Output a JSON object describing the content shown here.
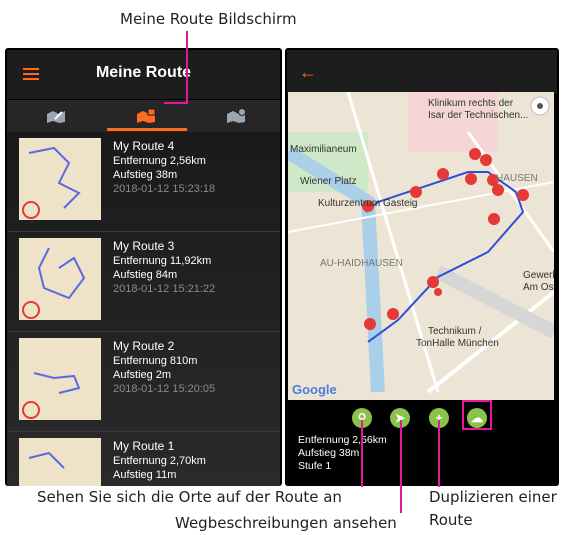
{
  "annotations": {
    "top_label": "Meine Route Bildschirm",
    "places_label": "Sehen Sie sich die Orte auf der Route an",
    "directions_label": "Wegbeschreibungen ansehen",
    "duplicate_label_1": "Duplizieren einer",
    "duplicate_label_2": "Route"
  },
  "left_screen": {
    "title": "Meine Route",
    "active_tab_index": 1,
    "routes": [
      {
        "name": "My Route 4",
        "distance": "Entfernung  2,56km",
        "ascent": "Aufstieg  38m",
        "date": "2018-01-12 15:23:18"
      },
      {
        "name": "My Route 3",
        "distance": "Entfernung  11,92km",
        "ascent": "Aufstieg  84m",
        "date": "2018-01-12 15:21:22"
      },
      {
        "name": "My Route 2",
        "distance": "Entfernung  810m",
        "ascent": "Aufstieg  2m",
        "date": "2018-01-12 15:20:05"
      },
      {
        "name": "My Route 1",
        "distance": "Entfernung  2,70km",
        "ascent": "Aufstieg  11m",
        "date": ""
      }
    ]
  },
  "right_screen": {
    "back_icon": "arrow-left-icon",
    "map_labels": {
      "klinikum": "Klinikum rechts der",
      "klinikum2": "Isar der Technischen...",
      "maximilianeum": "Maximilianeum",
      "wiener_platz": "Wiener Platz",
      "kulturzentrum": "Kulturzentrum Gasteig",
      "haidhausen": "AU-HAIDHAUSEN",
      "haidhausen_ne": "HAUSEN",
      "gewerbe": "Gewerb",
      "ost": "Am Ost",
      "technikum": "Technikum /",
      "tonhalle": "TonHalle München",
      "google": "Google"
    },
    "details": {
      "distance": "Entfernung  2,56km",
      "ascent": "Aufstieg  38m",
      "level": "Stufe  1"
    },
    "actions": [
      "location-pin-icon",
      "navigation-arrow-icon",
      "add-icon",
      "cloud-upload-icon"
    ]
  },
  "colors": {
    "accent": "#ff6a1f",
    "callout": "#e6179a",
    "action_green": "#8bc34a",
    "route": "#2b4fd6",
    "pin": "#e53935"
  }
}
